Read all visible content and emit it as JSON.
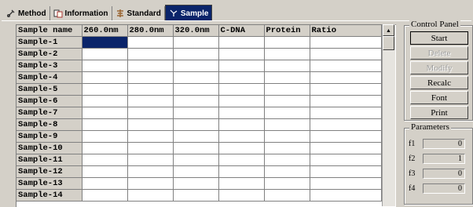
{
  "tabs": [
    {
      "label": "Method",
      "icon": "method-icon",
      "active": false
    },
    {
      "label": "Information",
      "icon": "information-icon",
      "active": false
    },
    {
      "label": "Standard",
      "icon": "standard-icon",
      "active": false
    },
    {
      "label": "Sample",
      "icon": "sample-icon",
      "active": true
    }
  ],
  "grid": {
    "headers": [
      "Sample name",
      "260.0nm",
      "280.0nm",
      "320.0nm",
      "C-DNA",
      "Protein",
      "Ratio"
    ],
    "rows": [
      "Sample-1",
      "Sample-2",
      "Sample-3",
      "Sample-4",
      "Sample-5",
      "Sample-6",
      "Sample-7",
      "Sample-8",
      "Sample-9",
      "Sample-10",
      "Sample-11",
      "Sample-12",
      "Sample-13",
      "Sample-14"
    ]
  },
  "control_panel": {
    "title": "Control Panel",
    "buttons": [
      {
        "label": "Start",
        "enabled": true
      },
      {
        "label": "Delete",
        "enabled": false
      },
      {
        "label": "Modify",
        "enabled": false
      },
      {
        "label": "Recalc",
        "enabled": true
      },
      {
        "label": "Font",
        "enabled": true
      },
      {
        "label": "Print",
        "enabled": true
      }
    ]
  },
  "parameters": {
    "title": "Parameters",
    "items": [
      {
        "label": "f1",
        "value": "0"
      },
      {
        "label": "f2",
        "value": "1"
      },
      {
        "label": "f3",
        "value": "0"
      },
      {
        "label": "f4",
        "value": "0"
      }
    ]
  },
  "colors": {
    "selection": "#0a246a",
    "face": "#d4d0c8"
  }
}
